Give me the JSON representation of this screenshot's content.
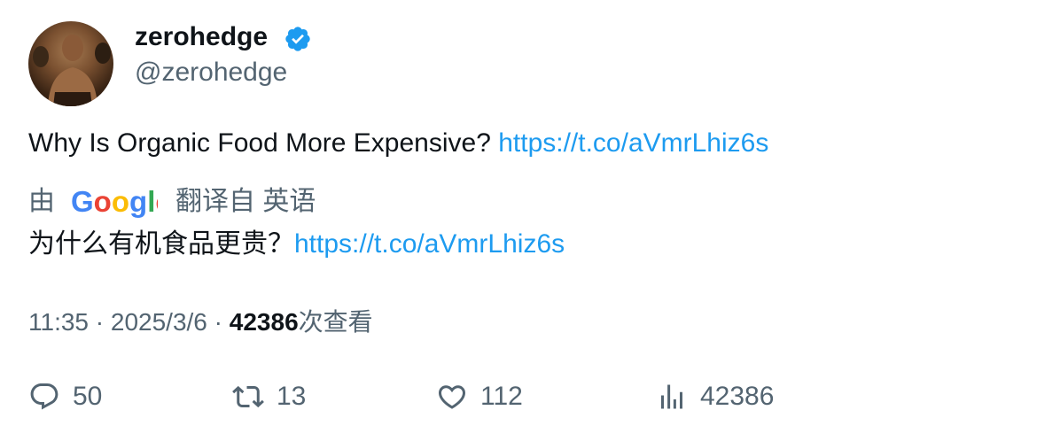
{
  "author": {
    "display_name": "zerohedge",
    "handle": "@zerohedge",
    "verified": true,
    "verified_color": "#1d9bf0"
  },
  "tweet": {
    "text": "Why Is Organic Food More Expensive? ",
    "link": "https://t.co/aVmrLhiz6s"
  },
  "translation": {
    "prefix": "由",
    "provider": "Google",
    "suffix": "翻译自 英语",
    "text": "为什么有机食品更贵？",
    "link": "https://t.co/aVmrLhiz6s"
  },
  "meta": {
    "time": "11:35",
    "separator": " · ",
    "date": "2025/3/6",
    "views_count": "42386",
    "views_label": "次查看"
  },
  "actions": {
    "replies": "50",
    "retweets": "13",
    "likes": "112",
    "views": "42386"
  },
  "colors": {
    "link": "#1d9bf0",
    "secondary_text": "#536471",
    "primary_text": "#0f1419"
  }
}
